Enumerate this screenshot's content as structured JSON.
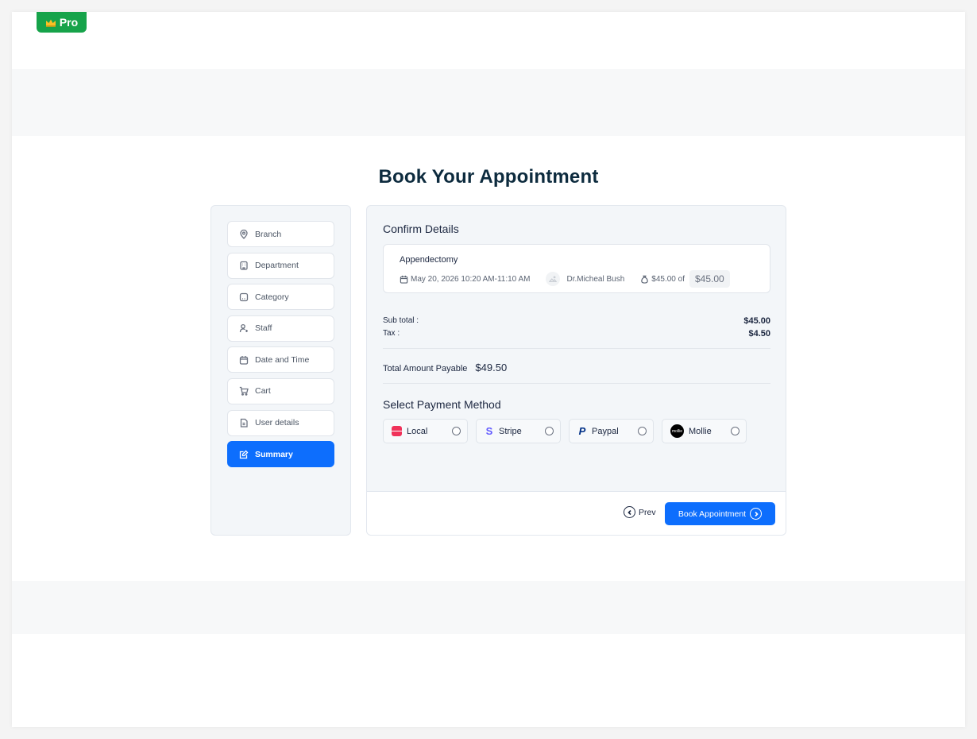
{
  "badge": {
    "label": "Pro"
  },
  "page": {
    "title": "Book Your Appointment"
  },
  "steps": [
    {
      "label": "Branch",
      "icon": "location-pin-icon"
    },
    {
      "label": "Department",
      "icon": "building-icon"
    },
    {
      "label": "Category",
      "icon": "category-icon"
    },
    {
      "label": "Staff",
      "icon": "user-plus-icon"
    },
    {
      "label": "Date and Time",
      "icon": "calendar-icon"
    },
    {
      "label": "Cart",
      "icon": "cart-icon"
    },
    {
      "label": "User details",
      "icon": "document-icon"
    },
    {
      "label": "Summary",
      "icon": "edit-note-icon",
      "active": true
    }
  ],
  "confirm": {
    "title": "Confirm Details",
    "service": "Appendectomy",
    "datetime": "May 20, 2026 10:20 AM-11:10 AM",
    "doctor": "Dr.Micheal Bush",
    "price_of": "$45.00 of",
    "price": "$45.00"
  },
  "summary": {
    "subtotal_label": "Sub total :",
    "subtotal_value": "$45.00",
    "tax_label": "Tax :",
    "tax_value": "$4.50",
    "total_label": "Total Amount Payable",
    "total_value": "$49.50"
  },
  "payment": {
    "title": "Select Payment Method",
    "methods": [
      {
        "label": "Local",
        "icon": "local-pay-icon"
      },
      {
        "label": "Stripe",
        "icon": "stripe-icon",
        "glyph": "S"
      },
      {
        "label": "Paypal",
        "icon": "paypal-icon",
        "glyph": "P"
      },
      {
        "label": "Mollie",
        "icon": "mollie-icon",
        "glyph": "mollie"
      }
    ]
  },
  "actions": {
    "prev": "Prev",
    "book": "Book Appointment"
  },
  "colors": {
    "primary": "#0d6efd",
    "badge": "#16a34a",
    "title": "#0d2b3e"
  }
}
